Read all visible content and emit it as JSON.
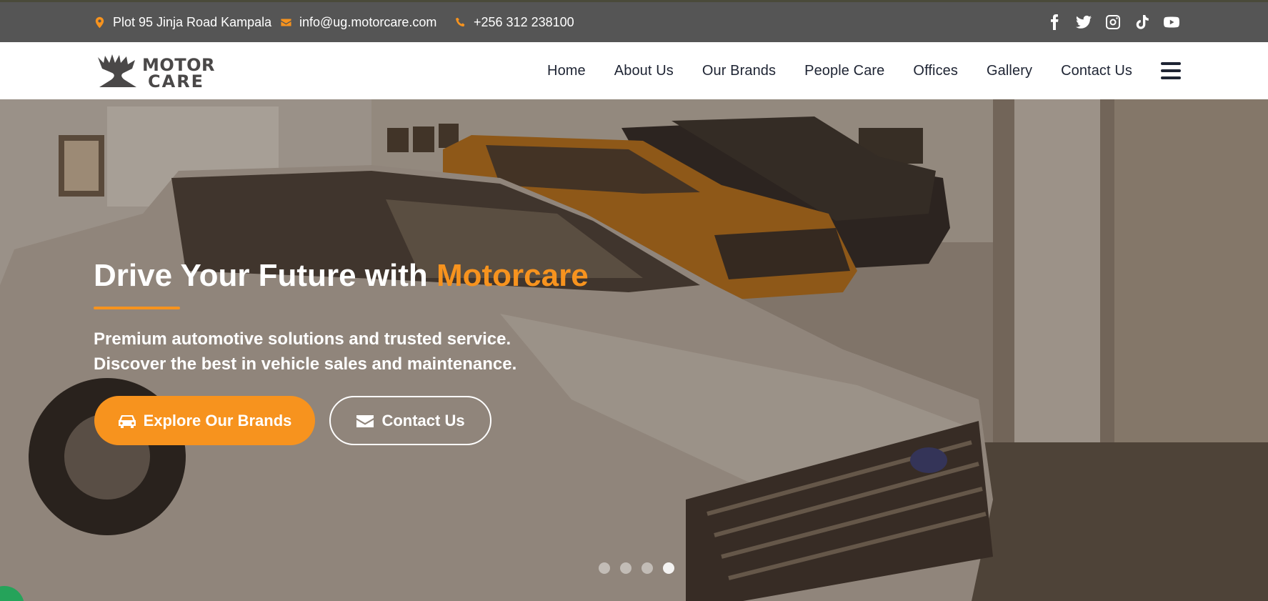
{
  "topbar": {
    "address": "Plot 95 Jinja Road Kampala",
    "email": "info@ug.motorcare.com",
    "phone": "+256 312 238100",
    "socials": [
      "facebook-icon",
      "twitter-icon",
      "instagram-icon",
      "tiktok-icon",
      "youtube-icon"
    ]
  },
  "brand": {
    "logo_line1": "MOTOR",
    "logo_line2": "CARE"
  },
  "nav": {
    "items": [
      "Home",
      "About Us",
      "Our Brands",
      "People Care",
      "Offices",
      "Gallery",
      "Contact Us"
    ]
  },
  "hero": {
    "title_prefix": "Drive Your Future with ",
    "title_accent": "Motorcare",
    "subtitle_line1": "Premium automotive solutions and trusted service.",
    "subtitle_line2": "Discover the best in vehicle sales and maintenance.",
    "primary_button": "Explore Our Brands",
    "secondary_button": "Contact Us",
    "slides": 4,
    "active_slide": 4
  },
  "colors": {
    "accent": "#f7931e",
    "topbar_bg": "#555555",
    "nav_text": "#1e2433"
  }
}
